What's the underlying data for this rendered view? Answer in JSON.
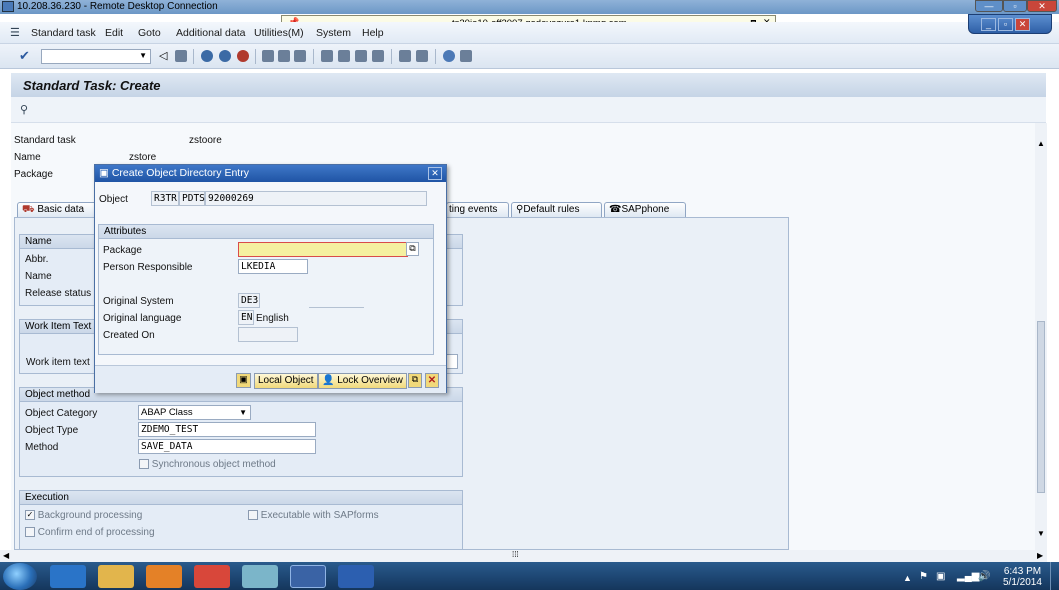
{
  "rdp": {
    "title": "10.208.36.230 - Remote Desktop Connection"
  },
  "connection": {
    "host": "ts20ie10-off2007.godevazure1.kpmg.com",
    "min": "_",
    "restore": "🗗",
    "close": "✕"
  },
  "menu": {
    "items": [
      "Standard task",
      "Edit",
      "Goto",
      "Additional data",
      "Utilities(M)",
      "System",
      "Help"
    ]
  },
  "page": {
    "title": "Standard Task: Create"
  },
  "header": {
    "standard_task_label": "Standard task",
    "standard_task_value": "zstoore",
    "name_label": "Name",
    "name_value": "zstore",
    "package_label": "Package"
  },
  "tabs": [
    "Basic data",
    "ting events",
    "Default rules",
    "SAPphone"
  ],
  "basic": {
    "name_group": "Name",
    "abbr_label": "Abbr.",
    "name_label": "Name",
    "release_label": "Release status",
    "wit_group": "Work Item Text",
    "wit_label": "Work item text",
    "om_group": "Object method",
    "obj_cat_label": "Object Category",
    "obj_cat_value": "ABAP Class",
    "obj_type_label": "Object Type",
    "obj_type_value": "ZDEMO_TEST",
    "method_label": "Method",
    "method_value": "SAVE_DATA",
    "sync_label": "Synchronous object method",
    "exec_group": "Execution",
    "bg_label": "Background processing",
    "confirm_label": "Confirm end of processing",
    "sapforms_label": "Executable with SAPforms"
  },
  "dialog": {
    "title": "Create Object Directory Entry",
    "object_label": "Object",
    "object_pgmid": "R3TR",
    "object_type": "PDTS",
    "object_name": "92000269",
    "attr_group": "Attributes",
    "package_label": "Package",
    "package_value": "",
    "person_label": "Person Responsible",
    "person_value": "LKEDIA",
    "orig_sys_label": "Original System",
    "orig_sys_value": "DE3",
    "orig_lang_label": "Original language",
    "orig_lang_code": "EN",
    "orig_lang_text": "English",
    "created_label": "Created On",
    "created_value": "",
    "local_object_btn": "Local Object",
    "lock_overview_btn": "Lock Overview"
  },
  "taskbar": {
    "time": "6:43 PM",
    "date": "5/1/2014"
  },
  "colors": {
    "accent": "#1f54a5",
    "required": "#f5f0a0",
    "sap_bg": "#eaf0f7"
  }
}
